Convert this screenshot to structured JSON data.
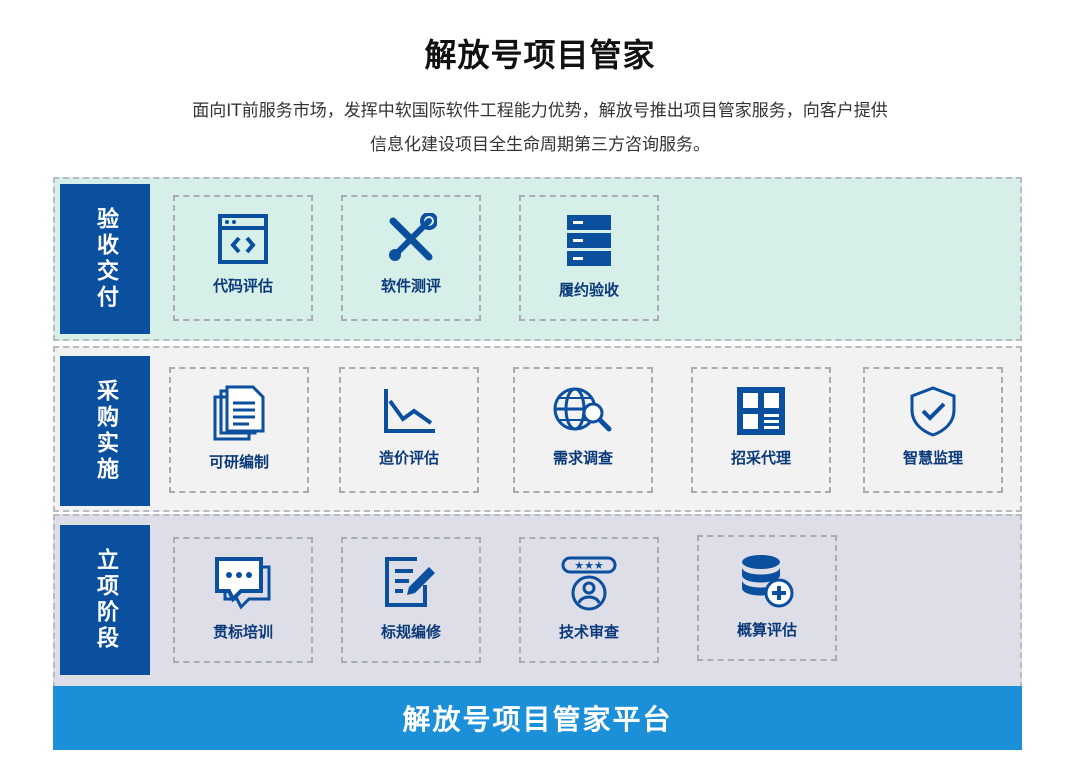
{
  "header": {
    "title": "解放号项目管家",
    "desc_line1": "面向IT前服务市场，发挥中软国际软件工程能力优势，解放号推出项目管家服务，向客户提供",
    "desc_line2": "信息化建设项目全生命周期第三方咨询服务。"
  },
  "stages": [
    {
      "name": "验收交付",
      "bg": "#d6efe9",
      "items": [
        {
          "label": "代码评估",
          "icon": "code-window-icon"
        },
        {
          "label": "软件测评",
          "icon": "wrench-screwdriver-icon"
        },
        {
          "label": "履约验收",
          "icon": "server-stack-icon"
        }
      ]
    },
    {
      "name": "采购实施",
      "bg": "#f2f2f2",
      "items": [
        {
          "label": "可研编制",
          "icon": "documents-icon"
        },
        {
          "label": "造价评估",
          "icon": "line-chart-icon"
        },
        {
          "label": "需求调查",
          "icon": "globe-search-icon"
        },
        {
          "label": "招采代理",
          "icon": "layout-grid-icon"
        },
        {
          "label": "智慧监理",
          "icon": "shield-check-icon"
        }
      ]
    },
    {
      "name": "立项阶段",
      "bg": "#dedee9",
      "items": [
        {
          "label": "贯标培训",
          "icon": "chat-bubbles-icon"
        },
        {
          "label": "标规编修",
          "icon": "edit-document-icon"
        },
        {
          "label": "技术审查",
          "icon": "rated-user-icon"
        },
        {
          "label": "概算评估",
          "icon": "database-add-icon"
        }
      ]
    }
  ],
  "platform": {
    "label": "解放号项目管家平台",
    "bg": "#1b90d9"
  },
  "colors": {
    "stage_bg": "#0b4f9f",
    "icon": "#0b4f9f",
    "label": "#0b3a7a"
  }
}
